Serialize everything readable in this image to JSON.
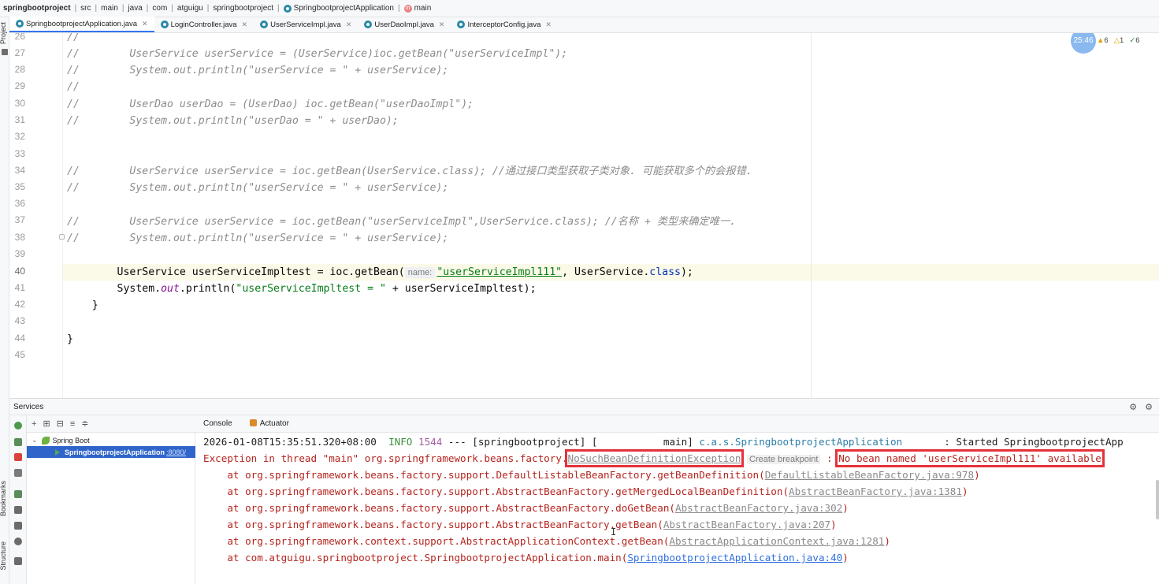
{
  "breadcrumb": {
    "items": [
      "springbootproject",
      "src",
      "main",
      "java",
      "com",
      "atguigu",
      "springbootproject",
      "SpringbootprojectApplication",
      "main"
    ]
  },
  "left_strip": {
    "project_label": "Project",
    "bookmarks_label": "Bookmarks",
    "structure_label": "Structure"
  },
  "tabs": [
    {
      "label": "SpringbootprojectApplication.java"
    },
    {
      "label": "LoginController.java"
    },
    {
      "label": "UserServiceImpl.java"
    },
    {
      "label": "UserDaoImpl.java"
    },
    {
      "label": "InterceptorConfig.java"
    }
  ],
  "editor": {
    "line_numbers": [
      "26",
      "27",
      "28",
      "29",
      "30",
      "31",
      "32",
      "33",
      "34",
      "35",
      "36",
      "37",
      "38",
      "39",
      "40",
      "41",
      "42",
      "43",
      "44",
      "45"
    ],
    "current_line": "40",
    "lines": {
      "l26": "//",
      "l27": "//        UserService userService = (UserService)ioc.getBean(\"userServiceImpl\");",
      "l28": "//        System.out.println(\"userService = \" + userService);",
      "l29": "//",
      "l30": "//        UserDao userDao = (UserDao) ioc.getBean(\"userDaoImpl\");",
      "l31": "//        System.out.println(\"userDao = \" + userDao);",
      "l34": "//        UserService userService = ioc.getBean(UserService.class); //通过接口类型获取子类对象. 可能获取多个的会报错.",
      "l35": "//        System.out.println(\"userService = \" + userService);",
      "l37": "//        UserService userService = ioc.getBean(\"userServiceImpl\",UserService.class); //名称 + 类型来确定唯一.",
      "l38": "//        System.out.println(\"userService = \" + userService);",
      "l40_a": "        UserService userServiceImpltest = ioc.getBean(",
      "l40_hint": "name:",
      "l40_str": "\"userServiceImpl111\"",
      "l40_b": ", UserService.",
      "l40_kw": "class",
      "l40_c": ");",
      "l41_a": "        System.",
      "l41_out": "out",
      "l41_b": ".println(",
      "l41_str": "\"userServiceImpltest = \"",
      "l41_c": " + userServiceImpltest);",
      "l42": "    }",
      "l44": "}"
    },
    "clock": "25:46",
    "inspections": {
      "warnings": "6",
      "weak_warnings": "1",
      "ok": "6"
    }
  },
  "services": {
    "title": "Services",
    "tree": {
      "spring_boot": "Spring Boot",
      "app": "SpringbootprojectApplication",
      "port": ":8080/"
    }
  },
  "console": {
    "tabs": [
      "Console",
      "Actuator"
    ],
    "line1": {
      "timestamp": "2026-01-08T15:35:51.320+08:00",
      "level": "INFO",
      "pid": "1544",
      "rest": " --- [springbootproject] [           main] ",
      "logger": "c.a.s.SpringbootprojectApplication",
      "msg": "       : Started SpringbootprojectApp"
    },
    "line2": {
      "prefix": "Exception in thread \"main\" org.springframework.beans.factory.",
      "exception": "NoSuchBeanDefinitionException",
      "breakpoint": "Create breakpoint",
      "colon": " : ",
      "message": "No bean named 'userServiceImpl111' available"
    },
    "stack": [
      {
        "at": "    at org.springframework.beans.factory.support.DefaultListableBeanFactory.getBeanDefinition(",
        "link": "DefaultListableBeanFactory.java:978",
        "end": ")"
      },
      {
        "at": "    at org.springframework.beans.factory.support.AbstractBeanFactory.getMergedLocalBeanDefinition(",
        "link": "AbstractBeanFactory.java:1381",
        "end": ")"
      },
      {
        "at": "    at org.springframework.beans.factory.support.AbstractBeanFactory.doGetBean(",
        "link": "AbstractBeanFactory.java:302",
        "end": ")"
      },
      {
        "at": "    at org.springframework.beans.factory.support.AbstractBeanFactory.getBean(",
        "link": "AbstractBeanFactory.java:207",
        "end": ")"
      },
      {
        "at": "    at org.springframework.context.support.AbstractApplicationContext.getBean(",
        "link": "AbstractApplicationContext.java:1281",
        "end": ")"
      },
      {
        "at": "    at com.atguigu.springbootproject.SpringbootprojectApplication.main(",
        "link": "SpringbootprojectApplication.java:40",
        "end": ")"
      }
    ]
  },
  "colors": {
    "accent": "#3574f0",
    "error_text": "#b4241e",
    "highlight_box": "#e5323a",
    "selection": "#2f65ca"
  }
}
